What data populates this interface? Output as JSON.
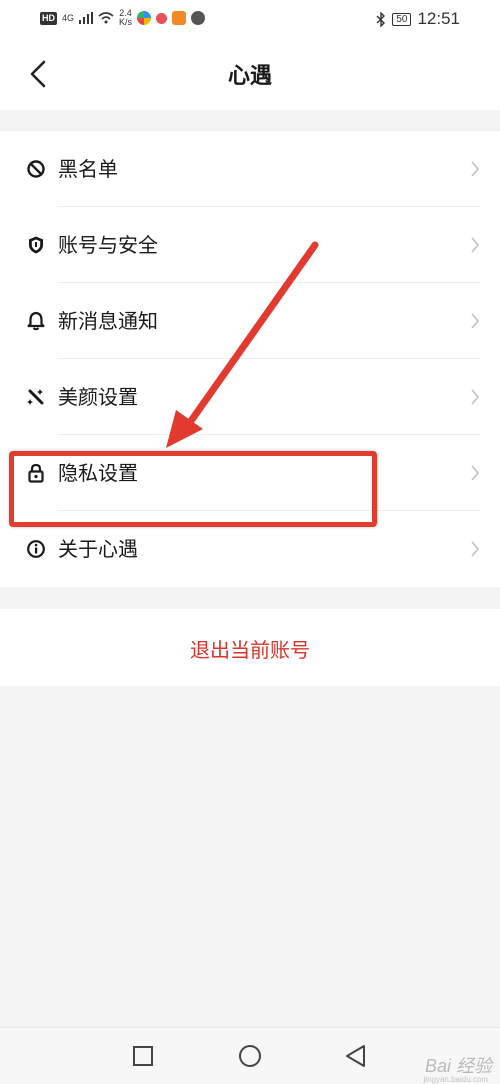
{
  "status_bar": {
    "hd": "HD",
    "network": "4G",
    "speed_value": "2.4",
    "speed_unit": "K/s",
    "battery": "50",
    "time": "12:51"
  },
  "header": {
    "title": "心遇",
    "back_icon": "chevron-left-icon"
  },
  "settings": {
    "items": [
      {
        "label": "黑名单",
        "icon": "block-icon"
      },
      {
        "label": "账号与安全",
        "icon": "shield-icon"
      },
      {
        "label": "新消息通知",
        "icon": "bell-icon"
      },
      {
        "label": "美颜设置",
        "icon": "wand-icon"
      },
      {
        "label": "隐私设置",
        "icon": "lock-icon"
      },
      {
        "label": "关于心遇",
        "icon": "info-icon"
      }
    ]
  },
  "logout_label": "退出当前账号",
  "colors": {
    "accent_red": "#d9342b",
    "annotation_red": "#e33a2f",
    "background": "#f3f3f3"
  },
  "watermark": {
    "text": "Bai 经验",
    "sub": "jingyan.baidu.com"
  }
}
